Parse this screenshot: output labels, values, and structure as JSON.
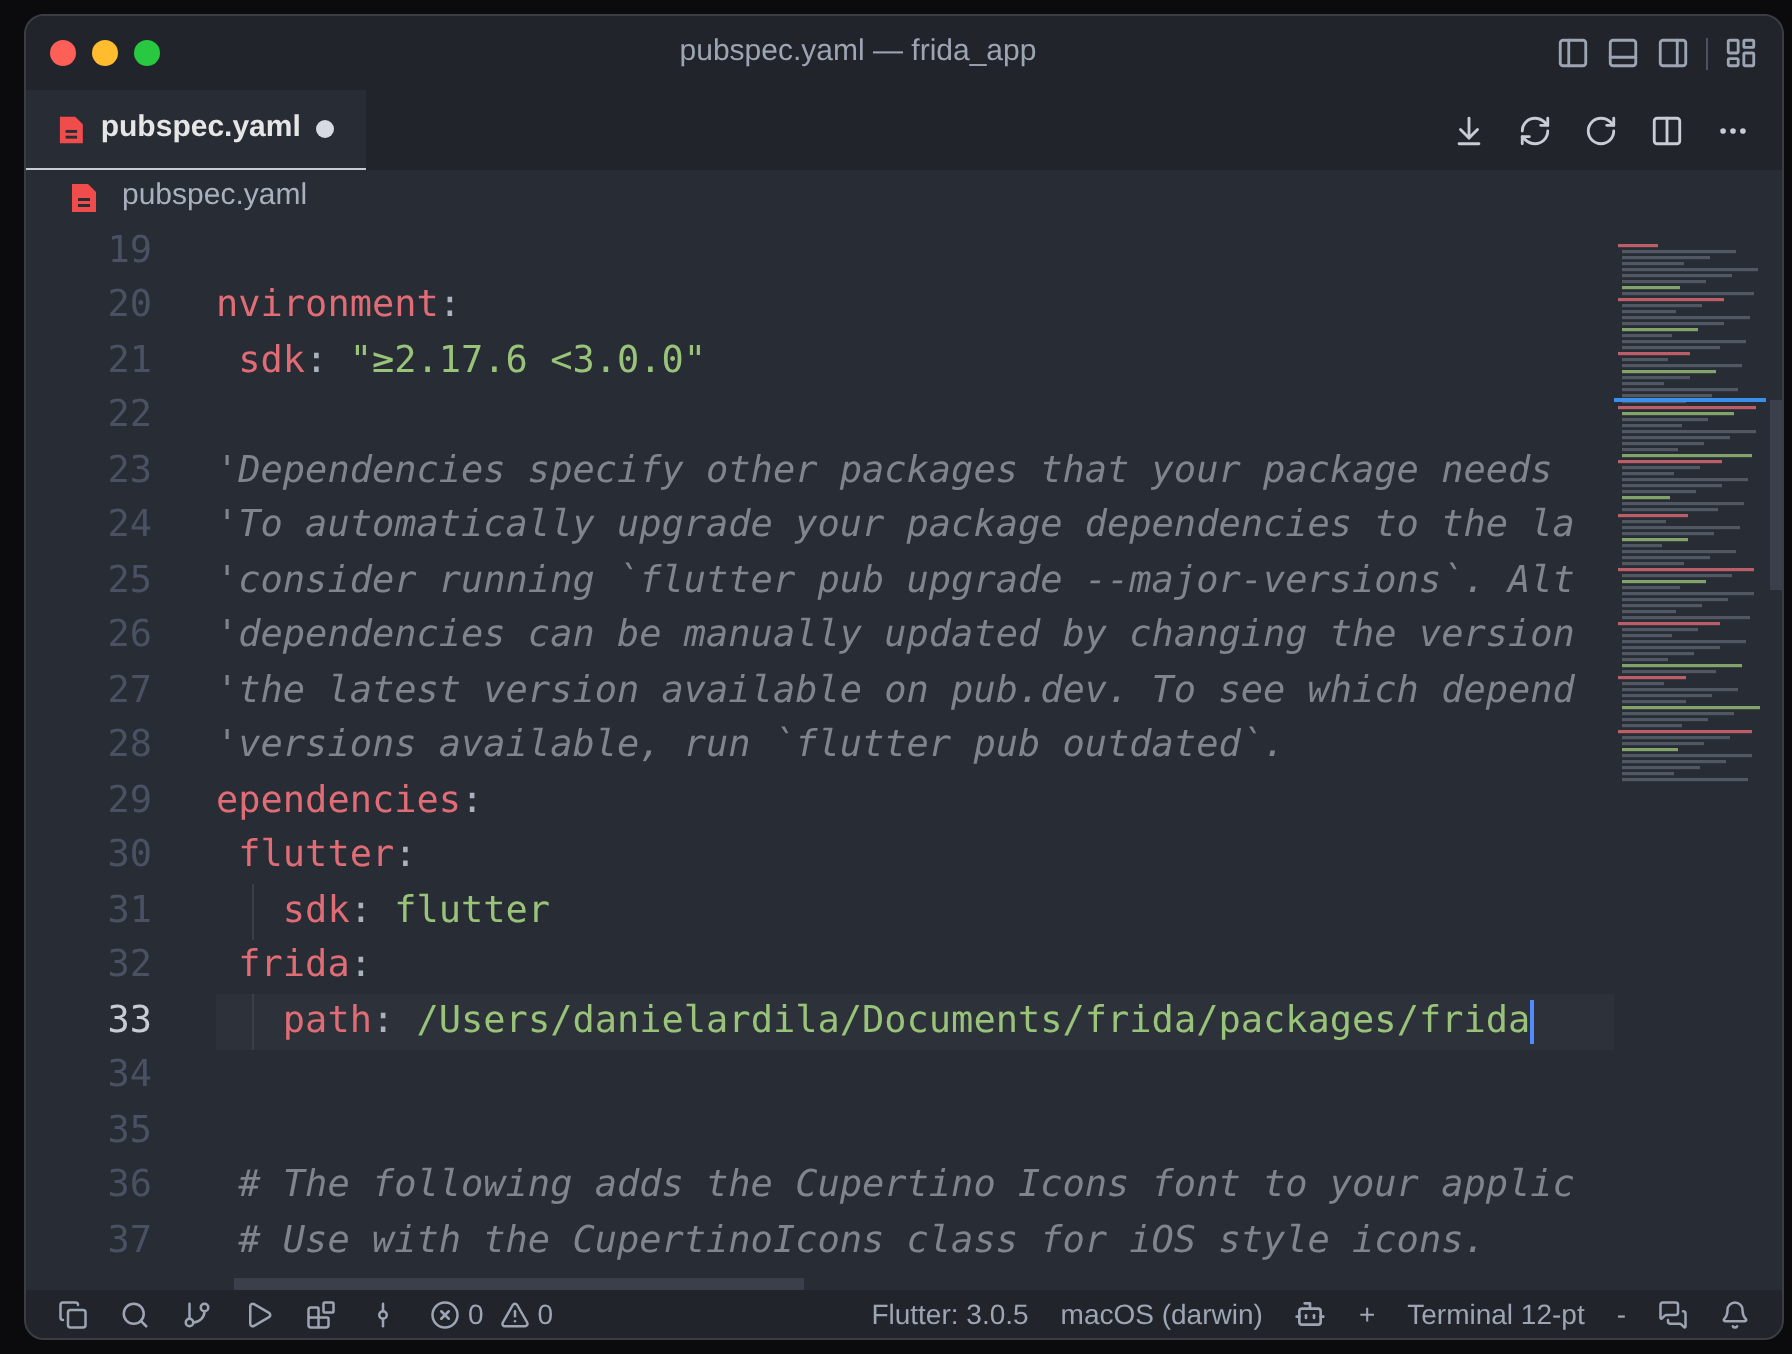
{
  "window": {
    "title": "pubspec.yaml — frida_app"
  },
  "tabs": [
    {
      "label": "pubspec.yaml",
      "selected": true,
      "modified": true
    }
  ],
  "breadcrumb": {
    "file": "pubspec.yaml"
  },
  "editor": {
    "lines": [
      {
        "number": "19",
        "selected": false,
        "indent_guide": false
      },
      {
        "number": "20",
        "selected": false,
        "indent_guide": false,
        "segments": [
          {
            "kind": "key",
            "text": "nvironment"
          },
          {
            "kind": "punct",
            "text": ":"
          }
        ]
      },
      {
        "number": "21",
        "selected": false,
        "indent_guide": false,
        "segments": [
          {
            "kind": "key",
            "text": " sdk"
          },
          {
            "kind": "punct",
            "text": ": "
          },
          {
            "kind": "string",
            "text": "\"≥2.17.6 <3.0.0\""
          }
        ]
      },
      {
        "number": "22",
        "selected": false,
        "indent_guide": false
      },
      {
        "number": "23",
        "selected": false,
        "indent_guide": false,
        "segments": [
          {
            "kind": "comment",
            "text": "'Dependencies specify other packages that your package needs"
          }
        ]
      },
      {
        "number": "24",
        "selected": false,
        "indent_guide": false,
        "segments": [
          {
            "kind": "comment",
            "text": "'To automatically upgrade your package dependencies to the la"
          }
        ]
      },
      {
        "number": "25",
        "selected": false,
        "indent_guide": false,
        "segments": [
          {
            "kind": "comment",
            "text": "'consider running `flutter pub upgrade --major-versions`. Alt"
          }
        ]
      },
      {
        "number": "26",
        "selected": false,
        "indent_guide": false,
        "segments": [
          {
            "kind": "comment",
            "text": "'dependencies can be manually updated by changing the version"
          }
        ]
      },
      {
        "number": "27",
        "selected": false,
        "indent_guide": false,
        "segments": [
          {
            "kind": "comment",
            "text": "'the latest version available on pub.dev. To see which depend"
          }
        ]
      },
      {
        "number": "28",
        "selected": false,
        "indent_guide": false,
        "segments": [
          {
            "kind": "comment",
            "text": "'versions available, run `flutter pub outdated`."
          }
        ]
      },
      {
        "number": "29",
        "selected": false,
        "indent_guide": false,
        "segments": [
          {
            "kind": "key",
            "text": "ependencies"
          },
          {
            "kind": "punct",
            "text": ":"
          }
        ]
      },
      {
        "number": "30",
        "selected": false,
        "indent_guide": false,
        "segments": [
          {
            "kind": "key",
            "text": " flutter"
          },
          {
            "kind": "punct",
            "text": ":"
          }
        ]
      },
      {
        "number": "31",
        "selected": false,
        "indent_guide": true,
        "segments": [
          {
            "kind": "key",
            "text": "   sdk"
          },
          {
            "kind": "punct",
            "text": ": "
          },
          {
            "kind": "string",
            "text": "flutter"
          }
        ]
      },
      {
        "number": "32",
        "selected": false,
        "indent_guide": false,
        "segments": [
          {
            "kind": "key",
            "text": " frida"
          },
          {
            "kind": "punct",
            "text": ":"
          }
        ]
      },
      {
        "number": "33",
        "selected": true,
        "indent_guide": true,
        "segments": [
          {
            "kind": "key",
            "text": "   path"
          },
          {
            "kind": "punct",
            "text": ": "
          },
          {
            "kind": "string",
            "text": "/Users/danielardila/Documents/frida/packages/frida"
          }
        ]
      },
      {
        "number": "34",
        "selected": false,
        "indent_guide": false
      },
      {
        "number": "35",
        "selected": false,
        "indent_guide": false
      },
      {
        "number": "36",
        "selected": false,
        "indent_guide": false,
        "segments": [
          {
            "kind": "comment",
            "text": " # The following adds the Cupertino Icons font to your applic"
          }
        ]
      },
      {
        "number": "37",
        "selected": false,
        "indent_guide": false,
        "segments": [
          {
            "kind": "comment",
            "text": " # Use with the CupertinoIcons class for iOS style icons."
          }
        ]
      }
    ]
  },
  "status_bar": {
    "errors": "0",
    "warnings": "0",
    "items": [
      "Flutter: 3.0.5",
      "macOS (darwin)"
    ],
    "plus": "+",
    "terminal": "Terminal 12-pt",
    "minus": "-"
  }
}
